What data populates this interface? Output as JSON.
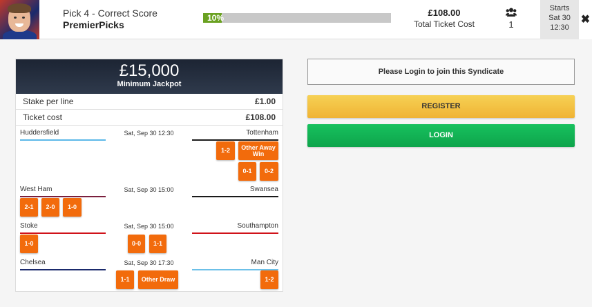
{
  "header": {
    "game_title": "Pick 4 - Correct Score",
    "syndicate_name": "PremierPicks",
    "progress_label": "10%",
    "progress_fraction": 0.1,
    "ticket_cost": "£108.00",
    "ticket_cost_label": "Total Ticket Cost",
    "members_count": "1",
    "starts_label": "Starts",
    "starts_day": "Sat 30",
    "starts_time": "12:30",
    "close_glyph": "✖"
  },
  "card": {
    "jackpot_amount": "£15,000",
    "jackpot_label": "Minimum Jackpot",
    "stake_label": "Stake per line",
    "stake_value": "£1.00",
    "ticket_label": "Ticket cost",
    "ticket_value": "£108.00"
  },
  "matches": [
    {
      "home": "Huddersfield",
      "away": "Tottenham",
      "kickoff": "Sat, Sep 30 12:30",
      "home_color": "#5bb8e8",
      "away_color": "#1a1a1a",
      "picks": [
        "1-2",
        "Other Away Win",
        "0-1",
        "0-2"
      ]
    },
    {
      "home": "West Ham",
      "away": "Swansea",
      "kickoff": "Sat, Sep 30 15:00",
      "home_color": "#7a1f3d",
      "away_color": "#1a1a1a",
      "picks": [
        "2-1",
        "2-0",
        "1-0"
      ]
    },
    {
      "home": "Stoke",
      "away": "Southampton",
      "kickoff": "Sat, Sep 30 15:00",
      "home_color": "#d0131a",
      "away_color": "#d0131a",
      "picks": [
        "1-0",
        "0-0",
        "1-1"
      ]
    },
    {
      "home": "Chelsea",
      "away": "Man City",
      "kickoff": "Sat, Sep 30 17:30",
      "home_color": "#1a2a6c",
      "away_color": "#6cc0e8",
      "picks": [
        "1-1",
        "Other Draw",
        "1-2"
      ]
    }
  ],
  "actions": {
    "login_message": "Please Login to join this Syndicate",
    "register_label": "REGISTER",
    "login_label": "LOGIN"
  },
  "colors": {
    "pick_chip": "#f26b0c",
    "progress": "#6aa121",
    "register": "#f0b334",
    "login": "#0ea44b"
  },
  "icons": [
    "members-icon",
    "close-icon"
  ]
}
